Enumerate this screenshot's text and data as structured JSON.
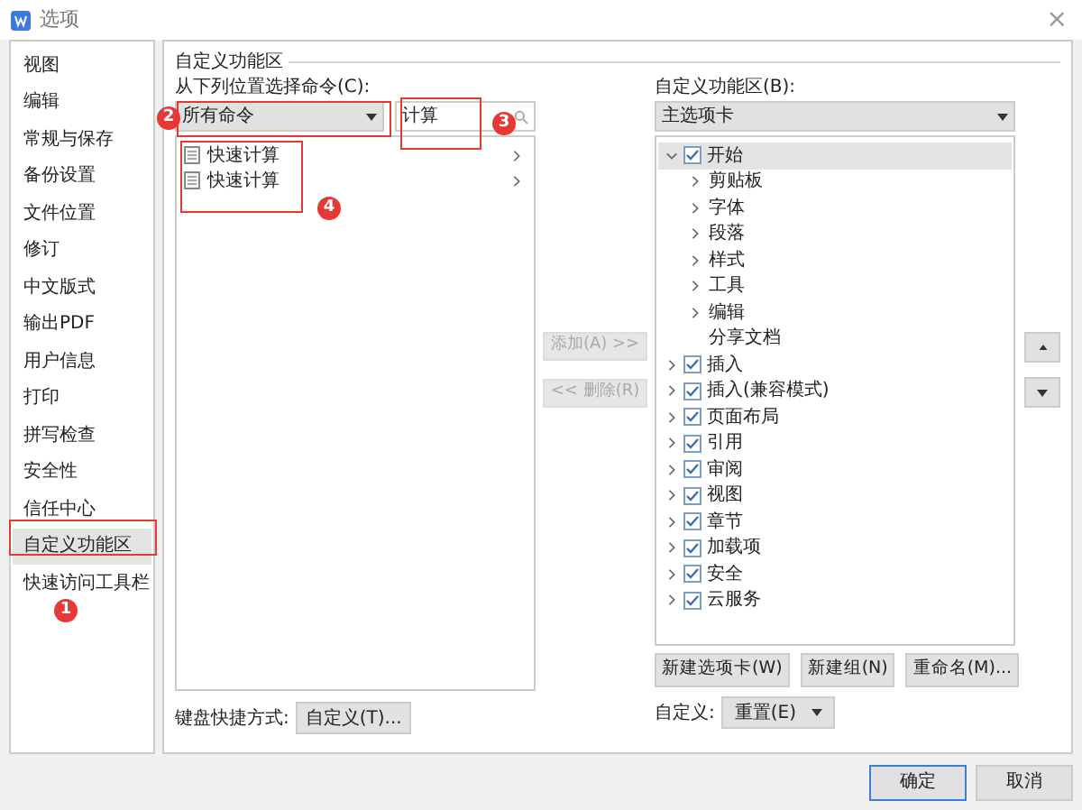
{
  "window": {
    "title": "选项",
    "close": "×"
  },
  "sidebar": {
    "items": [
      {
        "label": "视图",
        "selected": false
      },
      {
        "label": "编辑",
        "selected": false
      },
      {
        "label": "常规与保存",
        "selected": false
      },
      {
        "label": "备份设置",
        "selected": false
      },
      {
        "label": "文件位置",
        "selected": false
      },
      {
        "label": "修订",
        "selected": false
      },
      {
        "label": "中文版式",
        "selected": false
      },
      {
        "label": "输出PDF",
        "selected": false
      },
      {
        "label": "用户信息",
        "selected": false
      },
      {
        "label": "打印",
        "selected": false
      },
      {
        "label": "拼写检查",
        "selected": false
      },
      {
        "label": "安全性",
        "selected": false
      },
      {
        "label": "信任中心",
        "selected": false
      },
      {
        "label": "自定义功能区",
        "selected": true
      },
      {
        "label": "快速访问工具栏",
        "selected": false
      }
    ]
  },
  "section_title": "自定义功能区",
  "left": {
    "label": "从下列位置选择命令(C):",
    "source": "所有命令",
    "search": "计算",
    "commands": [
      {
        "label": "快速计算"
      },
      {
        "label": "快速计算"
      }
    ],
    "keyboard_label": "键盘快捷方式:",
    "keyboard_button": "自定义(T)..."
  },
  "middle": {
    "add": {
      "label": "添加(A) >>",
      "disabled": true
    },
    "remove": {
      "label": "<< 删除(R)",
      "disabled": true
    }
  },
  "right": {
    "label": "自定义功能区(B):",
    "source": "主选项卡",
    "tree": [
      {
        "label": "开始",
        "checked": true,
        "expanded": true,
        "selected": true,
        "children": [
          {
            "label": "剪贴板",
            "kind": "group"
          },
          {
            "label": "字体",
            "kind": "group"
          },
          {
            "label": "段落",
            "kind": "group"
          },
          {
            "label": "样式",
            "kind": "group"
          },
          {
            "label": "工具",
            "kind": "group"
          },
          {
            "label": "编辑",
            "kind": "group"
          },
          {
            "label": "分享文档",
            "kind": "command"
          }
        ]
      },
      {
        "label": "插入",
        "checked": true,
        "expanded": false,
        "selected": false
      },
      {
        "label": "插入(兼容模式)",
        "checked": true,
        "expanded": false,
        "selected": false
      },
      {
        "label": "页面布局",
        "checked": true,
        "expanded": false,
        "selected": false
      },
      {
        "label": "引用",
        "checked": true,
        "expanded": false,
        "selected": false
      },
      {
        "label": "审阅",
        "checked": true,
        "expanded": false,
        "selected": false
      },
      {
        "label": "视图",
        "checked": true,
        "expanded": false,
        "selected": false
      },
      {
        "label": "章节",
        "checked": true,
        "expanded": false,
        "selected": false
      },
      {
        "label": "加载项",
        "checked": true,
        "expanded": false,
        "selected": false
      },
      {
        "label": "安全",
        "checked": true,
        "expanded": false,
        "selected": false
      },
      {
        "label": "云服务",
        "checked": true,
        "expanded": false,
        "selected": false
      }
    ],
    "buttons": [
      "新建选项卡(W)",
      "新建组(N)",
      "重命名(M)..."
    ],
    "customize_label": "自定义:",
    "reset_button": "重置(E)"
  },
  "footer": {
    "buttons": [
      "确定",
      "取消"
    ]
  },
  "annotations": [
    {
      "label": "1"
    },
    {
      "label": "2"
    },
    {
      "label": "3"
    },
    {
      "label": "4"
    }
  ]
}
